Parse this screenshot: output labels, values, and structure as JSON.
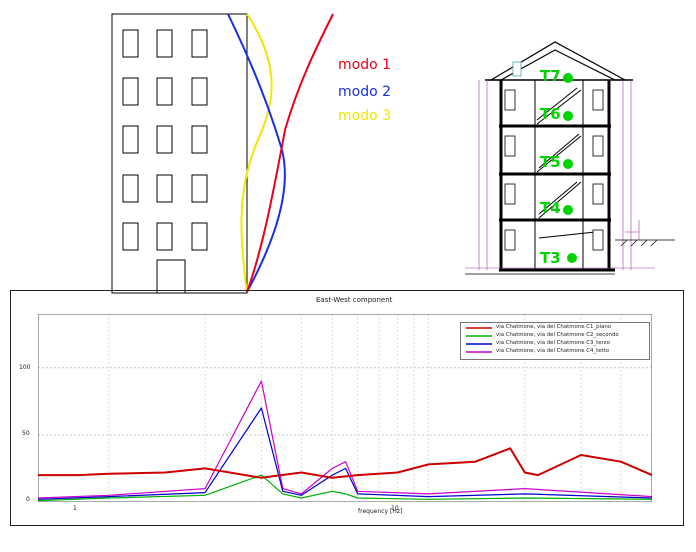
{
  "modes": {
    "mode1_label": "modo 1",
    "mode2_label": "modo 2",
    "mode3_label": "modo 3",
    "mode1_color": "#e8001c",
    "mode2_color": "#1a2ee6",
    "mode3_color": "#f2e600"
  },
  "section": {
    "sensors": [
      "T7",
      "T6",
      "T5",
      "T4",
      "T3"
    ],
    "sensor_color": "#00d400"
  },
  "chart_data": {
    "type": "line",
    "title": "East-West component",
    "xlabel": "frequency [Hz]",
    "ylabel": "",
    "x_scale": "log",
    "x_ticks": [
      "1",
      "10"
    ],
    "y_ticks": [
      "0",
      "50",
      "100"
    ],
    "ylim": [
      0,
      140
    ],
    "grid": true,
    "legend_position": "top-right",
    "series": [
      {
        "name": "via Chatmone, via del Chatmone C1_piano",
        "color": "#cc0000",
        "x": [
          0.6,
          0.8,
          1,
          1.5,
          2,
          3,
          4,
          5,
          6,
          8,
          10,
          14,
          18,
          20,
          22,
          30,
          40,
          50
        ],
        "y": [
          20,
          20,
          21,
          22,
          25,
          18,
          22,
          18,
          20,
          22,
          28,
          30,
          40,
          22,
          20,
          35,
          30,
          20
        ]
      },
      {
        "name": "via Chatmone, via del Chatmone C2_secondo",
        "color": "#00b000",
        "x": [
          0.6,
          1,
          2,
          3,
          3.5,
          4,
          5,
          5.5,
          6,
          10,
          20,
          50
        ],
        "y": [
          1,
          3,
          5,
          20,
          6,
          3,
          8,
          6,
          3,
          2,
          3,
          2
        ]
      },
      {
        "name": "via Chatmone, via del Chatmone C3_terzo",
        "color": "#0000cc",
        "x": [
          0.6,
          1,
          2,
          3,
          3.5,
          4,
          5,
          5.5,
          6,
          10,
          20,
          50
        ],
        "y": [
          2,
          4,
          7,
          70,
          8,
          5,
          20,
          25,
          6,
          4,
          6,
          3
        ]
      },
      {
        "name": "via Chatmone, via del Chatmone C4_tetto",
        "color": "#cc00cc",
        "x": [
          0.6,
          1,
          2,
          3,
          3.5,
          4,
          5,
          5.5,
          6,
          10,
          20,
          50
        ],
        "y": [
          3,
          5,
          10,
          90,
          10,
          6,
          25,
          30,
          8,
          6,
          10,
          4
        ]
      }
    ]
  }
}
